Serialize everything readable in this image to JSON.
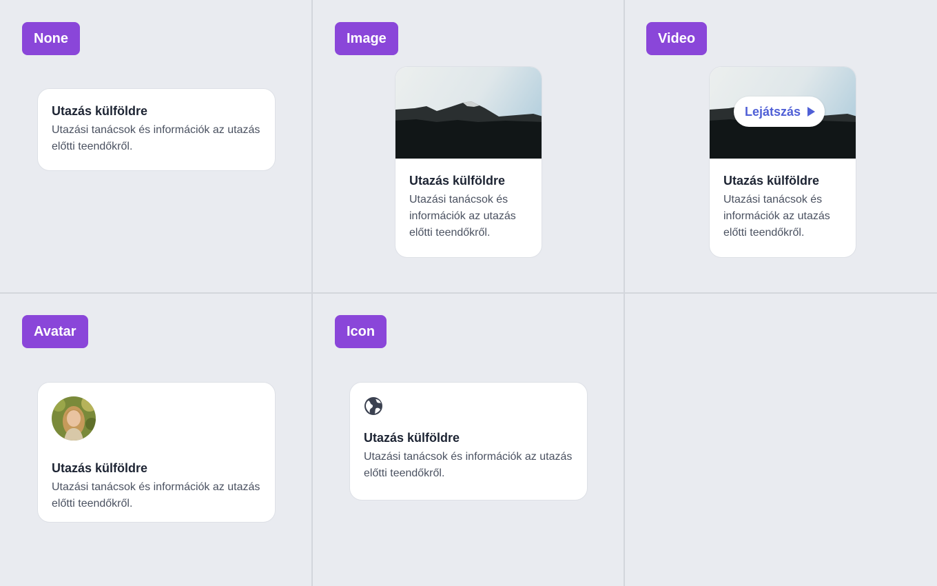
{
  "variants": {
    "none": "None",
    "image": "Image",
    "video": "Video",
    "avatar": "Avatar",
    "icon": "Icon"
  },
  "card": {
    "title": "Utazás külföldre",
    "description": "Utazási tanácsok és információk az utazás előtti teendőkről."
  },
  "video": {
    "play_label": "Lejátszás"
  },
  "icons": {
    "play": "play-icon",
    "globe": "globe-icon",
    "avatar": "avatar-photo"
  },
  "colors": {
    "tag": "#8a46d9",
    "accent": "#4f5fd6",
    "background": "#e9ebf0"
  }
}
